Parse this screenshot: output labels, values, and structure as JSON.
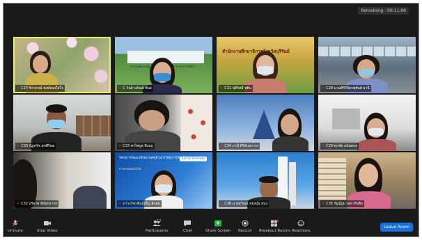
{
  "meeting": {
    "remaining": "Remaining : 00:11:06"
  },
  "participants": [
    {
      "label": "C27 จิราภรณ์ พงษ์ทองใส่ใจ"
    },
    {
      "label": "C วันอ้างคัณย์ พันธ"
    },
    {
      "label": "C31 ชุติรัศมี ชุติน"
    },
    {
      "label": "C28 นวนศิริวิจิตรตุพันธ์ ธานี"
    },
    {
      "label": "C30 นัฏทรัช สุขศีรินต"
    },
    {
      "label": "C33 พรไพบูล ชิงนฤ"
    },
    {
      "label": "C34 ภานี ศิริจันทรากร"
    },
    {
      "label": "C29 ศุภชัย อนันตกุล"
    },
    {
      "label": "C32 อริยาศ ลีมีทุกอาทร"
    },
    {
      "label": "ภาวะวิชาพันธุ์เพ็ญ ลิกสม"
    },
    {
      "label": "C36 นายธวิษณ์ ทองปุ่น สนง"
    },
    {
      "label": "C35 รัฐญ์ภูมาสทาภัชพิล"
    }
  ],
  "tile_texts": {
    "office_banner": "สำนักงานศึกษาธิการจังหวัดบุรีรัมย์",
    "banner_small": "สถาบันพัฒนาครู คณาจารย์ และบุคลากรทางการศึกษา",
    "slide_text": "โครงการพัฒนาศักยภาพครูด้านการจัดการเรียนรู้",
    "slide_sub": "ผ่านระบบออนไลน์",
    "ask_unmute": "Ask to Unmute"
  },
  "toolbar": {
    "unmute": "Unmute",
    "stop_video": "Stop Video",
    "participants": "Participants",
    "participants_count": "12",
    "chat": "Chat",
    "share_screen": "Share Screen",
    "record": "Record",
    "breakout_rooms": "Breakout Rooms",
    "reactions": "Reactions",
    "leave_room": "Leave Room"
  },
  "colors": {
    "active_speaker": "#e8f05a",
    "share_green": "#24b24a",
    "leave_blue": "#1570d8",
    "muted_red": "#e53935"
  }
}
